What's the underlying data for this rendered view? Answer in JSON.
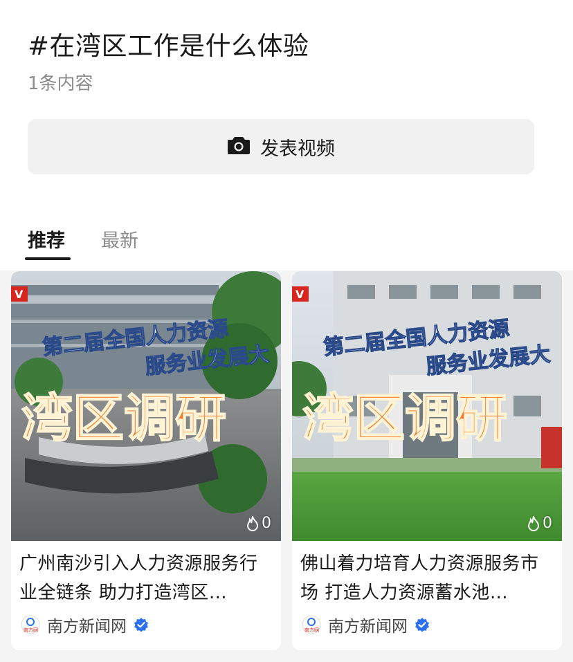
{
  "header": {
    "title": "#在湾区工作是什么体验",
    "subtitle": "1条内容"
  },
  "publish": {
    "label": "发表视频",
    "icon": "camera-icon"
  },
  "tabs": [
    {
      "label": "推荐",
      "active": true
    },
    {
      "label": "最新",
      "active": false
    }
  ],
  "cards": [
    {
      "title": "广州南沙引入人力资源服务行业全链条 助力打造湾区…",
      "thumb_line1": "第二届全国人力资源",
      "thumb_line2": "服务业发展大",
      "thumb_big": "湾区调研",
      "count": "0",
      "author": "南方新闻网",
      "verified": true
    },
    {
      "title": "佛山着力培育人力资源服务市场 打造人力资源蓄水池…",
      "thumb_line1": "第二届全国人力资源",
      "thumb_line2": "服务业发展大",
      "thumb_big": "湾区调研",
      "count": "0",
      "author": "南方新闻网",
      "verified": true
    }
  ],
  "colors": {
    "accent_verified": "#2b6ff2",
    "headline_orange": "#f07a2a",
    "page_bg": "#f4f4f4"
  }
}
